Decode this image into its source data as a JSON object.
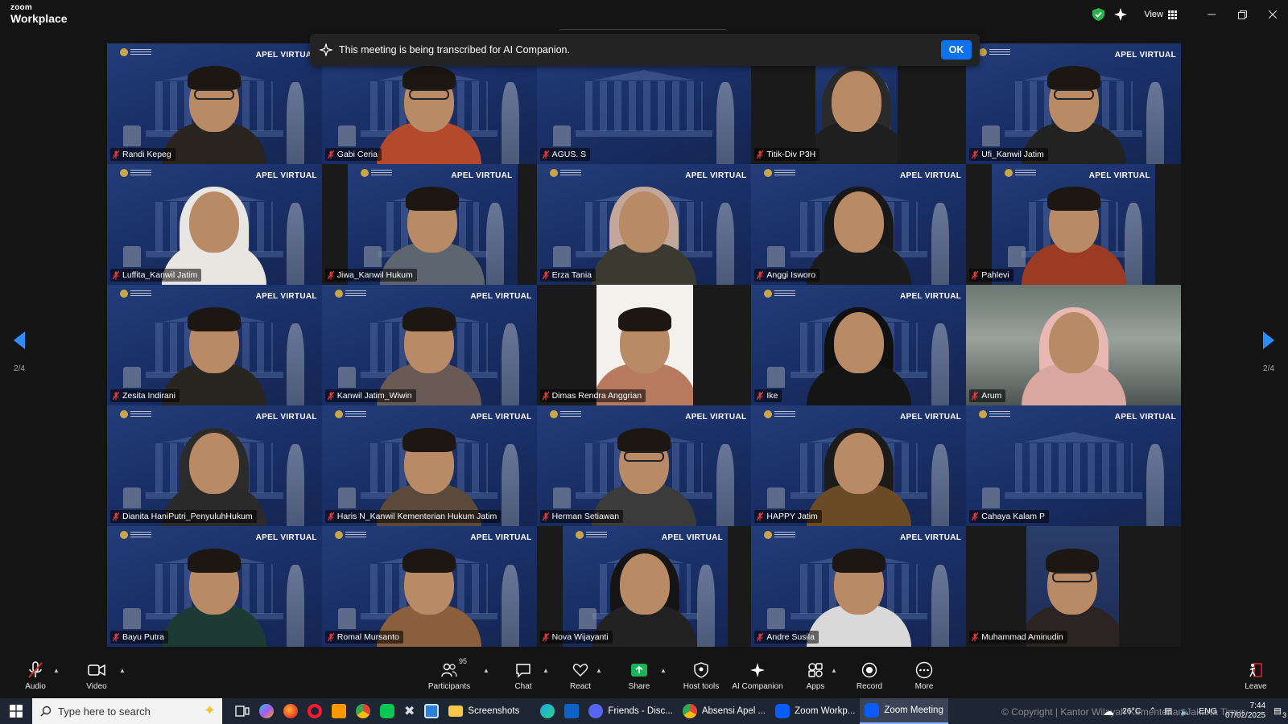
{
  "app": {
    "brand_top": "zoom",
    "brand_bottom": "Workplace",
    "view_label": "View"
  },
  "banner": {
    "text": "This meeting is being transcribed for AI Companion.",
    "ok_label": "OK"
  },
  "tile_badge": "APEL VIRTUAL",
  "tiles": [
    {
      "name": "Randi Kepeg"
    },
    {
      "name": "Gabi Ceria"
    },
    {
      "name": "AGUS. S"
    },
    {
      "name": "Titik-Div P3H"
    },
    {
      "name": "Ufi_Kanwil Jatim"
    },
    {
      "name": "Luffita_Kanwil Jatim"
    },
    {
      "name": "Jiwa_Kanwil Hukum"
    },
    {
      "name": "Erza Tania"
    },
    {
      "name": "Anggi Isworo"
    },
    {
      "name": "Pahlevi"
    },
    {
      "name": "Zesita Indirani"
    },
    {
      "name": "Kanwil Jatim_Wiwin"
    },
    {
      "name": "Dimas Rendra Anggrian"
    },
    {
      "name": "Ike"
    },
    {
      "name": "Arum"
    },
    {
      "name": "Dianita HaniPutri_PenyuluhHukum"
    },
    {
      "name": "Haris N_Kanwil Kementerian Hukum Jatim"
    },
    {
      "name": "Herman Setiawan"
    },
    {
      "name": "HAPPY Jatim"
    },
    {
      "name": "Cahaya Kalam P"
    },
    {
      "name": "Bayu Putra"
    },
    {
      "name": "Romal Mursanto"
    },
    {
      "name": "Nova Wijayanti"
    },
    {
      "name": "Andre Susila"
    },
    {
      "name": "Muhammad Aminudin"
    }
  ],
  "pagination": {
    "left": "2/4",
    "right": "2/4"
  },
  "toolbar": {
    "audio": "Audio",
    "video": "Video",
    "participants": "Participants",
    "participant_count": "95",
    "chat": "Chat",
    "react": "React",
    "share": "Share",
    "host_tools": "Host tools",
    "ai_companion": "AI Companion",
    "apps": "Apps",
    "record": "Record",
    "more": "More",
    "leave": "Leave"
  },
  "taskbar": {
    "search_placeholder": "Type here to search",
    "apps": [
      "Screenshots",
      "Friends - Disc...",
      "Absensi Apel ...",
      "Zoom Workp...",
      "Zoom Meeting"
    ],
    "temperature": "26°C",
    "language": "ENG",
    "time": "7:44",
    "date": "07/02/2025",
    "notification_count": "3"
  },
  "watermark": "© Copyright | Kantor Wilayah Kementerian Jakarta Timur"
}
